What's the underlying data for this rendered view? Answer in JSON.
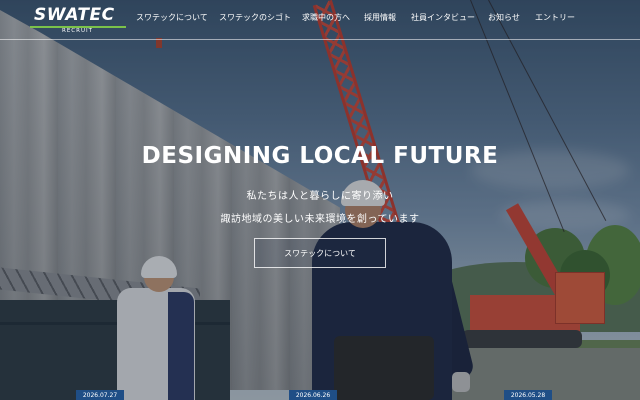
{
  "header": {
    "logo_text": "SWATEC",
    "logo_sub": "RECRUIT",
    "nav": [
      {
        "label": "スワテックについて"
      },
      {
        "label": "スワテックのシゴト"
      },
      {
        "label": "求職中の方へ"
      },
      {
        "label": "採用情報"
      },
      {
        "label": "社員インタビュー"
      },
      {
        "label": "お知らせ"
      },
      {
        "label": "エントリー"
      }
    ]
  },
  "hero": {
    "title": "DESIGNING LOCAL FUTURE",
    "line1": "私たちは人と暮らしに寄り添い",
    "line2": "諏訪地域の美しい未来環境を創っています",
    "cta_label": "スワテックについて"
  },
  "news": {
    "dates": [
      "2026.07.27",
      "2026.06.26",
      "2026.05.28"
    ]
  },
  "colors": {
    "accent_green": "#7bc24a",
    "badge_blue": "#1f4e86",
    "crane_red": "#d24a3a"
  }
}
